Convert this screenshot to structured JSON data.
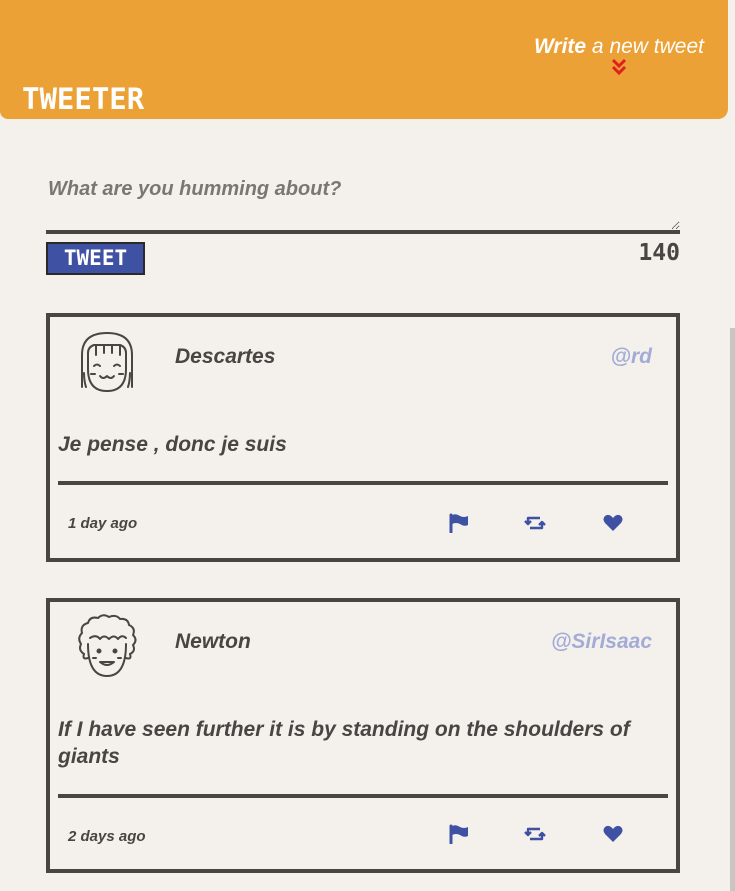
{
  "header": {
    "brand": "TWEETER",
    "write_strong": "Write",
    "write_rest": " a new tweet"
  },
  "compose": {
    "placeholder": "What are you humming about?",
    "value": "",
    "button_label": "TWEET",
    "counter": "140"
  },
  "tweets": [
    {
      "name": "Descartes",
      "handle": "@rd",
      "text": "Je pense , donc je suis",
      "time": "1 day ago",
      "avatar_icon": "avatar-girl-icon"
    },
    {
      "name": "Newton",
      "handle": "@SirIsaac",
      "text": "If I have seen further it is by standing on the shoulders of giants",
      "time": "2 days ago",
      "avatar_icon": "avatar-curly-hair-icon"
    }
  ],
  "icons": {
    "flag": "flag-icon",
    "retweet": "retweet-icon",
    "heart": "heart-icon",
    "chevron": "double-chevron-down-icon"
  },
  "colors": {
    "header_bg": "#eba135",
    "page_bg": "#f4f1ed",
    "accent_blue": "#3f51a3",
    "handle_color": "#a3acd6",
    "chevron_red": "#e0201e",
    "text_dark": "#4a4542"
  }
}
